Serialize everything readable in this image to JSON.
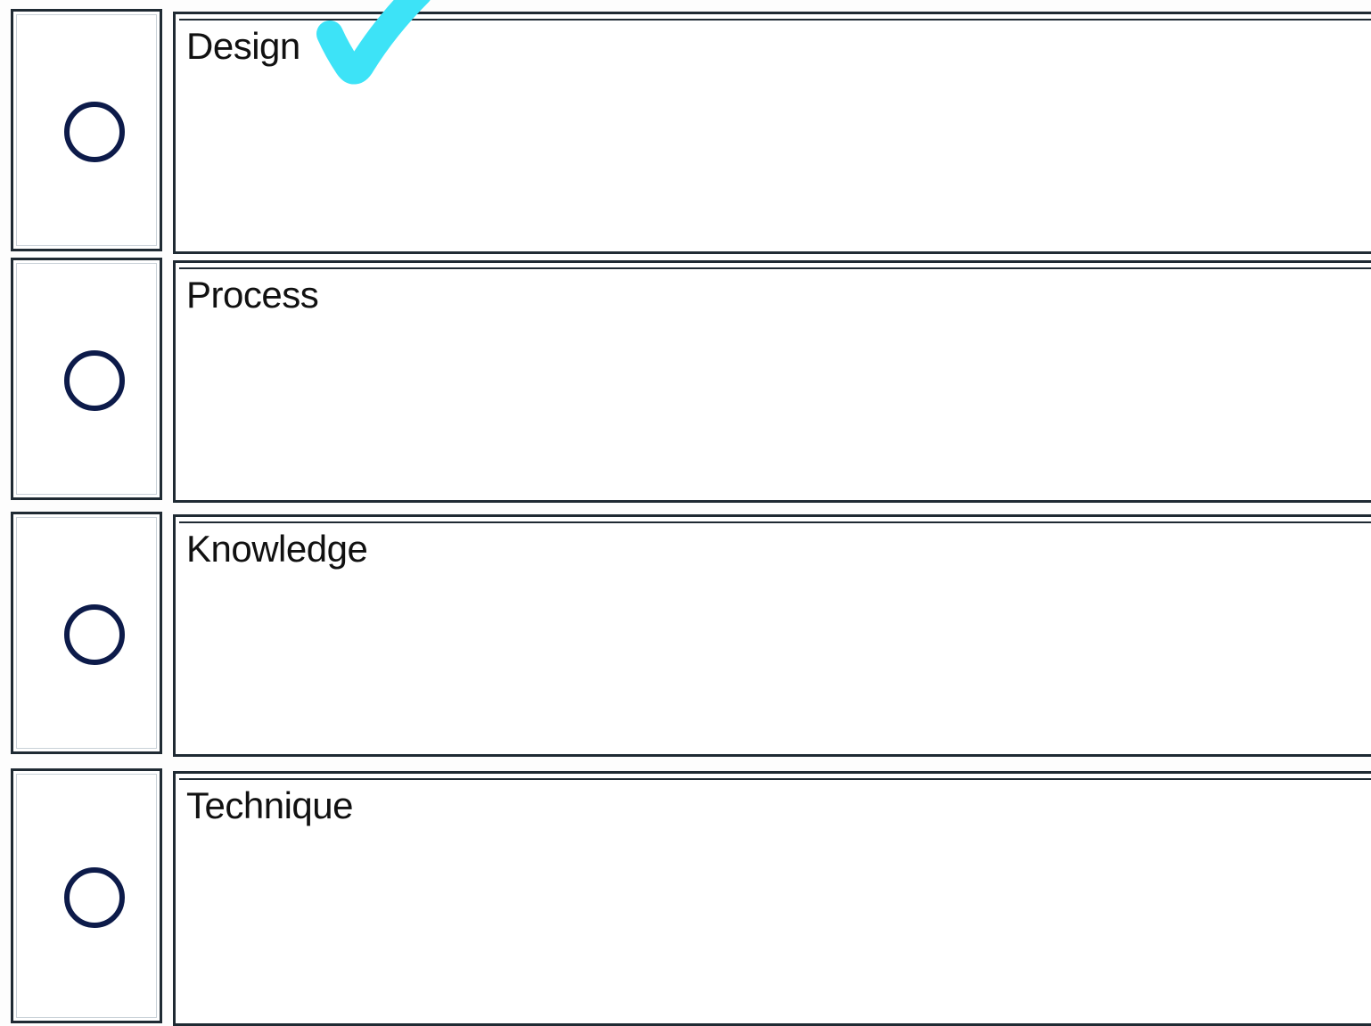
{
  "question": {
    "options": [
      {
        "label": "Design",
        "marked": true
      },
      {
        "label": "Process",
        "marked": false
      },
      {
        "label": "Knowledge",
        "marked": false
      },
      {
        "label": "Technique",
        "marked": false
      }
    ]
  },
  "colors": {
    "border": "#1f2a33",
    "radio": "#0d1b4a",
    "checkmark": "#3de3f7",
    "text": "#111111"
  },
  "icons": {
    "radio": "radio-circle-icon",
    "mark": "checkmark-icon"
  }
}
